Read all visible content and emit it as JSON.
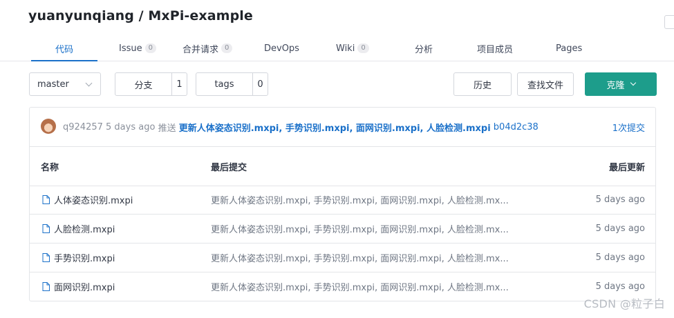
{
  "repo": {
    "title": "yuanyunqiang / MxPi-example"
  },
  "tabs": [
    {
      "label": "代码",
      "count": null
    },
    {
      "label": "Issue",
      "count": "0"
    },
    {
      "label": "合并请求",
      "count": "0"
    },
    {
      "label": "DevOps",
      "count": null
    },
    {
      "label": "Wiki",
      "count": "0"
    },
    {
      "label": "分析",
      "count": null
    },
    {
      "label": "项目成员",
      "count": null
    },
    {
      "label": "Pages",
      "count": null
    }
  ],
  "toolbar": {
    "branch": "master",
    "branches_label": "分支",
    "branches_count": "1",
    "tags_label": "tags",
    "tags_count": "0",
    "history_label": "历史",
    "find_file_label": "查找文件",
    "clone_label": "克隆"
  },
  "latest_commit": {
    "author": "q924257",
    "time": "5 days ago",
    "action": "推送",
    "message": "更新人体姿态识别.mxpi, 手势识别.mxpi, 面网识别.mxpi, 人脸检测.mxpi",
    "hash": "b04d2c38",
    "count_label": "1次提交"
  },
  "table": {
    "headers": {
      "name": "名称",
      "last_commit": "最后提交",
      "last_update": "最后更新"
    },
    "rows": [
      {
        "name": "人体姿态识别.mxpi",
        "commit": "更新人体姿态识别.mxpi, 手势识别.mxpi, 面网识别.mxpi, 人脸检测.mx...",
        "updated": "5 days ago"
      },
      {
        "name": "人脸检测.mxpi",
        "commit": "更新人体姿态识别.mxpi, 手势识别.mxpi, 面网识别.mxpi, 人脸检测.mx...",
        "updated": "5 days ago"
      },
      {
        "name": "手势识别.mxpi",
        "commit": "更新人体姿态识别.mxpi, 手势识别.mxpi, 面网识别.mxpi, 人脸检测.mx...",
        "updated": "5 days ago"
      },
      {
        "name": "面网识别.mxpi",
        "commit": "更新人体姿态识别.mxpi, 手势识别.mxpi, 面网识别.mxpi, 人脸检测.mx...",
        "updated": "5 days ago"
      }
    ]
  },
  "watermark": "CSDN @粒子白",
  "colors": {
    "accent": "#1a70c9",
    "clone_button": "#1d9d8b",
    "border": "#e3e5e8"
  },
  "icons": {
    "file": "file-icon",
    "avatar": "avatar",
    "chevron": "chevron-down-icon"
  }
}
